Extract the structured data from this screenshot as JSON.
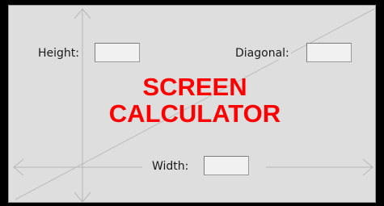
{
  "title": {
    "line1": "SCREEN",
    "line2": "CALCULATOR"
  },
  "fields": {
    "height": {
      "label": "Height:",
      "value": ""
    },
    "diagonal": {
      "label": "Diagonal:",
      "value": ""
    },
    "width": {
      "label": "Width:",
      "value": ""
    }
  },
  "colors": {
    "title": "#ff0000",
    "panel": "#dedede",
    "guides": "#b9b9b9",
    "background": "#000000"
  }
}
